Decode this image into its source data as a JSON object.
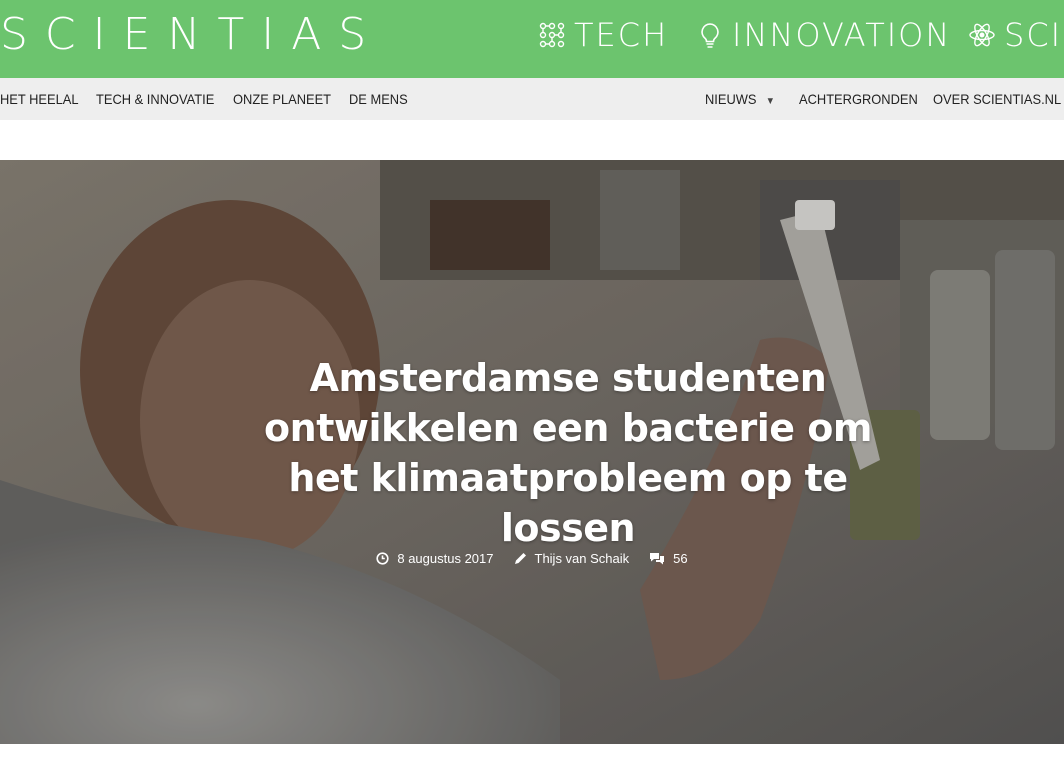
{
  "brand": {
    "logo_text": "SCIENTIAS"
  },
  "categories": [
    {
      "label": "TECH",
      "icon": "molecule-grid-icon"
    },
    {
      "label": "INNOVATION",
      "icon": "lightbulb-icon"
    },
    {
      "label": "SCIE",
      "icon": "atom-icon"
    }
  ],
  "nav": {
    "left": [
      "HET HEELAL",
      "TECH & INNOVATIE",
      "ONZE PLANEET",
      "DE MENS"
    ],
    "right": [
      "NIEUWS",
      "ACHTERGRONDEN",
      "OVER SCIENTIAS.NL"
    ]
  },
  "article": {
    "title": "Amsterdamse studenten ontwikkelen een bacterie om het klimaatprobleem op te lossen",
    "date": "8 augustus 2017",
    "author": "Thijs van Schaik",
    "comments": "56",
    "hero_image": "scientist-pipetting-photo"
  },
  "colors": {
    "brand_green": "#6cc46e",
    "nav_bg": "#eeeeee"
  }
}
